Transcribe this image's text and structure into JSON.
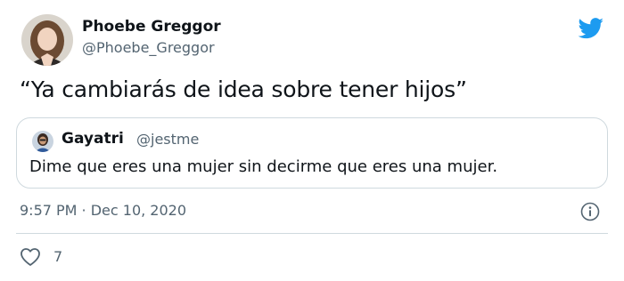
{
  "author": {
    "display_name": "Phoebe Greggor",
    "handle": "@Phoebe_Greggor"
  },
  "tweet": {
    "text": "“Ya cambiarás de idea sobre tener hijos”",
    "timestamp": "9:57 PM · Dec 10, 2020",
    "like_count": "7"
  },
  "quoted_tweet": {
    "display_name": "Gayatri",
    "handle": "@jestme",
    "text": "Dime que eres una mujer sin decirme que eres una mujer."
  },
  "icons": {
    "brand": "twitter-bird-icon",
    "info": "info-icon",
    "like": "heart-icon"
  },
  "colors": {
    "brand_blue": "#1d9bf0",
    "secondary_text": "#536471",
    "border": "#cfd9de"
  }
}
